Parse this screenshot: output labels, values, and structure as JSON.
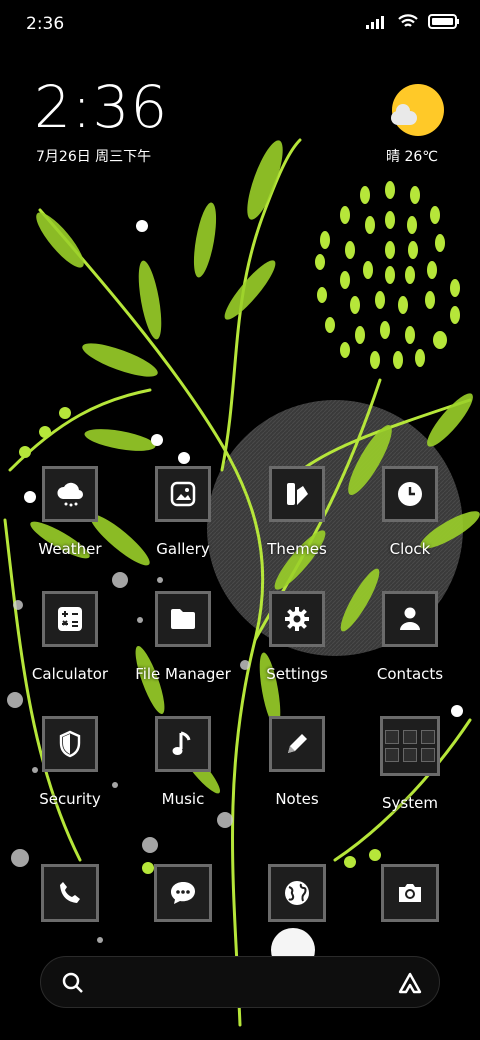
{
  "status_bar": {
    "time": "2:36",
    "icons": [
      "signal-icon",
      "wifi-icon",
      "battery-icon"
    ]
  },
  "clock_widget": {
    "time": "2:36",
    "date": "7月26日 周三下午"
  },
  "weather_widget": {
    "text": "晴 26℃",
    "icon": "sunny-cloud-icon"
  },
  "apps": [
    {
      "label": "Weather",
      "icon": "weather-icon"
    },
    {
      "label": "Gallery",
      "icon": "gallery-icon"
    },
    {
      "label": "Themes",
      "icon": "themes-icon"
    },
    {
      "label": "Clock",
      "icon": "clock-icon"
    },
    {
      "label": "Calculator",
      "icon": "calculator-icon"
    },
    {
      "label": "File Manager",
      "icon": "folder-icon"
    },
    {
      "label": "Settings",
      "icon": "gear-icon"
    },
    {
      "label": "Contacts",
      "icon": "person-icon"
    },
    {
      "label": "Security",
      "icon": "shield-icon"
    },
    {
      "label": "Music",
      "icon": "music-note-icon"
    },
    {
      "label": "Notes",
      "icon": "pencil-icon"
    },
    {
      "label": "System",
      "icon": "folder-grid-icon"
    }
  ],
  "dock": [
    {
      "icon": "phone-icon"
    },
    {
      "icon": "message-icon"
    },
    {
      "icon": "browser-globe-icon"
    },
    {
      "icon": "camera-icon"
    }
  ],
  "search_bar": {
    "left_icon": "search-icon",
    "right_icon": "assistant-icon"
  },
  "colors": {
    "accent": "#b6e63a",
    "sun": "#ffc928",
    "tile_border": "#6b6b6b",
    "tile_bg": "#1e1e1e"
  }
}
